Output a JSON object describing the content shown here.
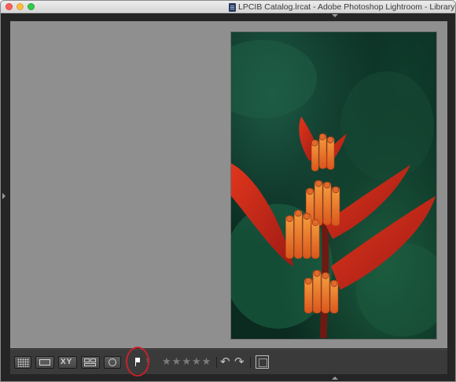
{
  "window": {
    "title": "LPCIB Catalog.lrcat - Adobe Photoshop Lightroom - Library"
  },
  "toolbar": {
    "view_buttons": [
      {
        "name": "grid-view",
        "icon": "grid-icon"
      },
      {
        "name": "loupe-view",
        "icon": "loupe-icon"
      },
      {
        "name": "compare-view",
        "icon": "compare-icon",
        "label": "XY"
      },
      {
        "name": "survey-view",
        "icon": "survey-icon"
      },
      {
        "name": "people-view",
        "icon": "people-icon"
      }
    ],
    "flag": {
      "icon": "pick-flag-icon",
      "state": "flagged"
    },
    "reject": {
      "icon": "reject-x-icon",
      "label": "×"
    },
    "rating": {
      "stars": 5,
      "value": 0,
      "star_glyph": "★"
    },
    "rotate_left_glyph": "↶",
    "rotate_right_glyph": "↷",
    "crop": {
      "icon": "crop-icon"
    }
  },
  "annotation": {
    "color": "#c8222a",
    "target": "pick-flag"
  },
  "photo": {
    "subject": "heliconia-flower"
  }
}
